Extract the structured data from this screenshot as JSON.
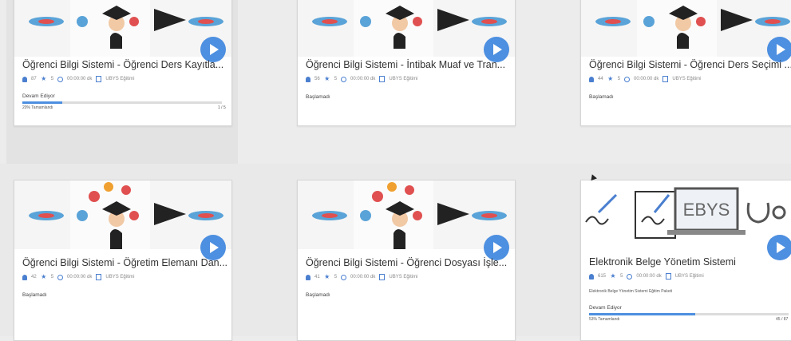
{
  "colors": {
    "accent": "#4d8fe0",
    "progress": "#4d8fe0",
    "icon": "#4a7fcf"
  },
  "cards": [
    {
      "title": "Öğrenci Bilgi Sistemi - Öğrenci Ders Kayıtla...",
      "students": "87",
      "rating": "5",
      "duration": "00:00:00 dk",
      "category": "UBYS Eğitimi",
      "status": "Devam Ediyor",
      "progress_label": "20% Tamamlandı",
      "progress_count": "1 / 5",
      "progress": 0.2
    },
    {
      "title": "Öğrenci Bilgi Sistemi - İntibak Muaf ve Tran...",
      "students": "56",
      "rating": "5",
      "duration": "00:00:00 dk",
      "category": "UBYS Eğitimi",
      "status": "Başlamadı"
    },
    {
      "title": "Öğrenci Bilgi Sistemi - Öğrenci Ders Seçimi ...",
      "students": "44",
      "rating": "5",
      "duration": "00:00:00 dk",
      "category": "UBYS Eğitimi",
      "status": "Başlamadı"
    },
    {
      "title": "Öğrenci Bilgi Sistemi - Öğretim Elemanı Dan...",
      "students": "42",
      "rating": "5",
      "duration": "00:00:00 dk",
      "category": "UBYS Eğitimi",
      "status": "Başlamadı"
    },
    {
      "title": "Öğrenci Bilgi Sistemi - Öğrenci Dosyası İşle...",
      "students": "41",
      "rating": "5",
      "duration": "00:00:00 dk",
      "category": "UBYS Eğitimi",
      "status": "Başlamadı"
    },
    {
      "title": "Elektronik Belge Yönetim Sistemi",
      "students": "615",
      "rating": "5",
      "duration": "00:00:00 dk",
      "category": "UBYS Eğitimi",
      "description": "Elektronik Belge Yönetim Sistemi Eğitim Paketi",
      "status": "Devam Ediyor",
      "progress_label": "53% Tamamlandı",
      "progress_count": "45 / 87",
      "progress": 0.53,
      "thumb_text": "EBYS"
    }
  ]
}
